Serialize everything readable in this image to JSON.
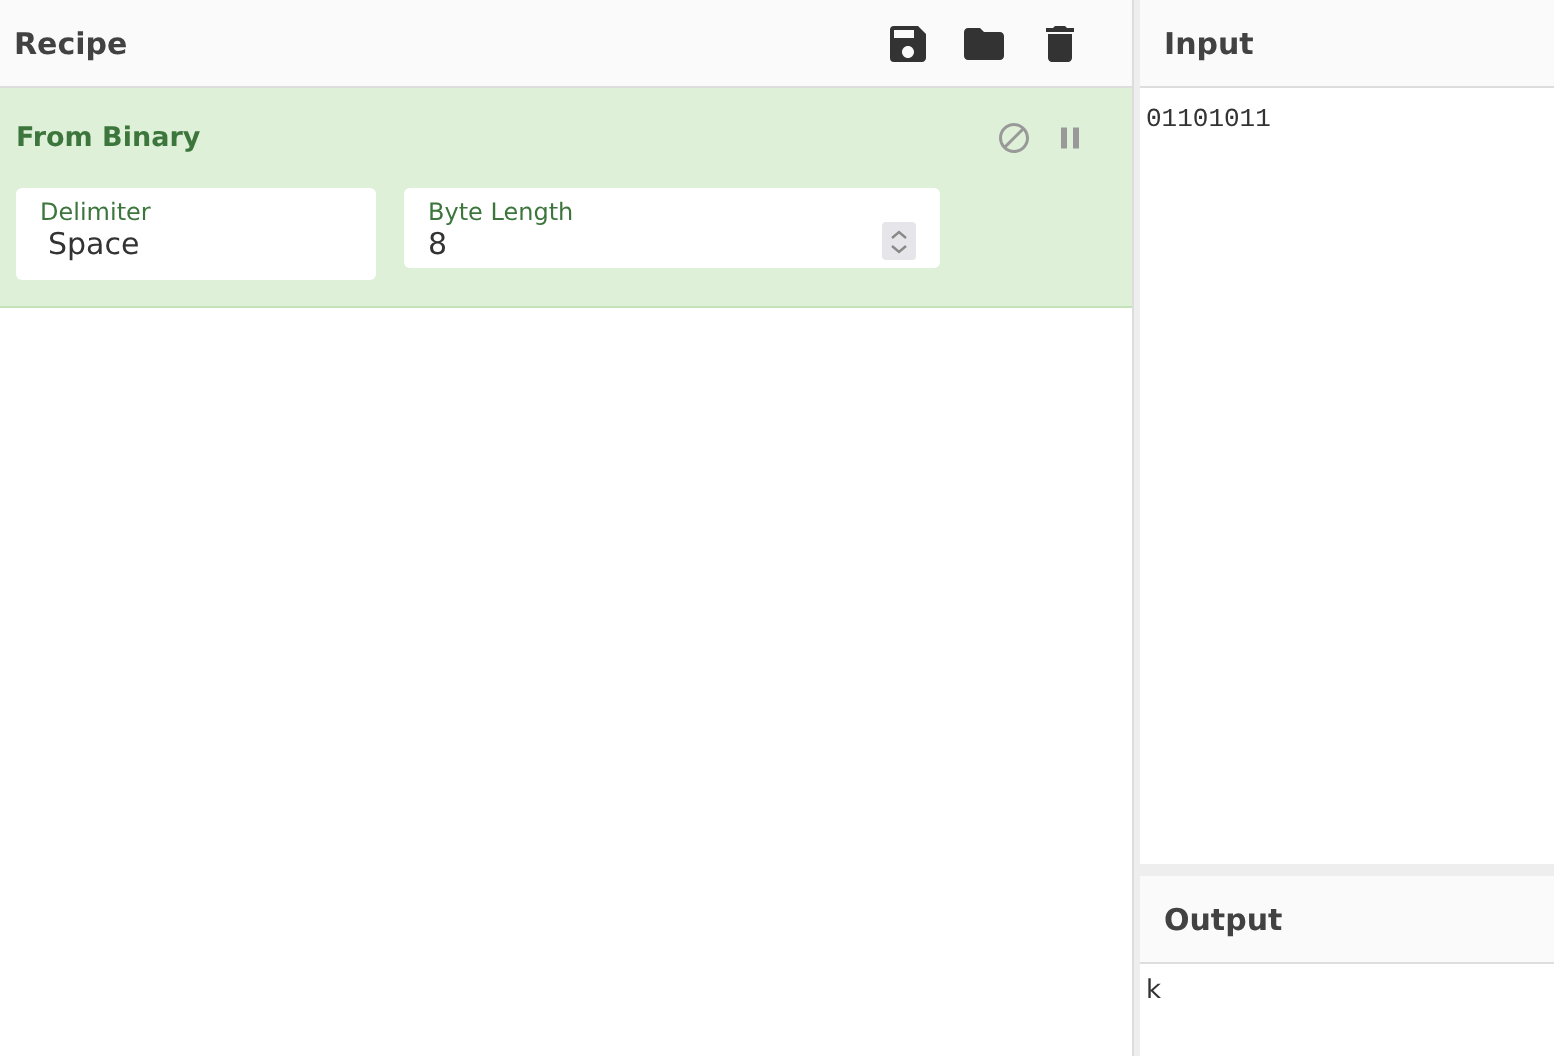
{
  "recipe": {
    "title": "Recipe",
    "operations": [
      {
        "name": "From Binary",
        "args": [
          {
            "kind": "select",
            "label": "Delimiter",
            "value": "Space"
          },
          {
            "kind": "number",
            "label": "Byte Length",
            "value": "8"
          }
        ]
      }
    ]
  },
  "input": {
    "title": "Input",
    "value": "01101011"
  },
  "output": {
    "title": "Output",
    "value": "k"
  }
}
